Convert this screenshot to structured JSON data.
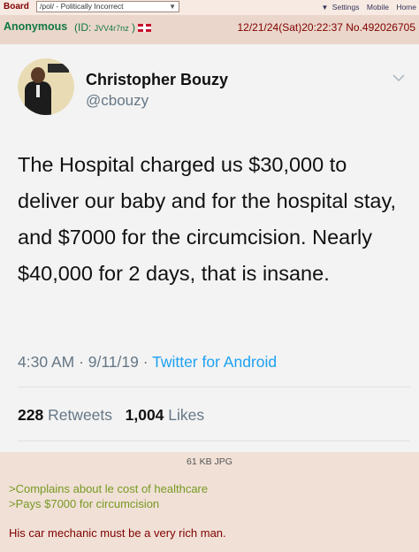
{
  "topbar": {
    "board_label": "Board",
    "board_select": "/pol/ - Politically Incorrect",
    "links": [
      "Settings",
      "Mobile",
      "Home"
    ]
  },
  "post": {
    "name": "Anonymous",
    "id_prefix": "(ID: ",
    "id_value": "JVV4r7nz",
    "id_suffix": ")",
    "date": "12/21/24(Sat)20:22:37 No.492026705",
    "file_info": "61 KB JPG",
    "greentext": [
      ">Complains about le cost of healthcare",
      ">Pays $7000 for circumcision"
    ],
    "text": "His car mechanic must be a very rich man."
  },
  "tweet": {
    "display_name": "Christopher Bouzy",
    "handle": "@cbouzy",
    "body": "The Hospital charged us $30,000 to deliver our baby and for the hospital stay, and $7000 for the circumcision. Nearly $40,000 for 2 days, that is insane.",
    "time": "4:30 AM · 9/11/19 · ",
    "source": "Twitter for Android",
    "retweets_count": "228",
    "retweets_label": "Retweets",
    "likes_count": "1,004",
    "likes_label": "Likes"
  },
  "colors": {
    "post_bg": "#f0e0d6",
    "name_green": "#117743",
    "greentext": "#789922",
    "link_blue": "#1da1f2"
  }
}
